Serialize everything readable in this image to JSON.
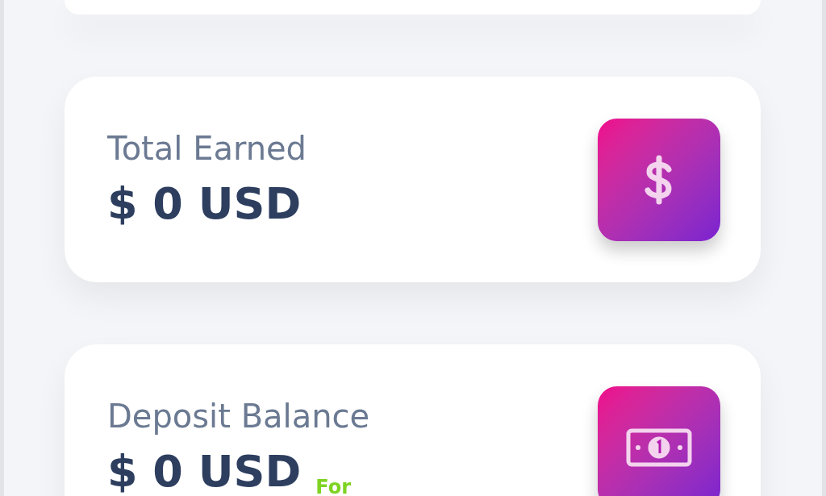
{
  "stats": [
    {
      "label": "Total Earned",
      "value": "$ 0 USD",
      "kind": "earned"
    },
    {
      "label": "Deposit Balance",
      "value": "$ 0 USD",
      "note": "For",
      "kind": "deposit"
    }
  ]
}
